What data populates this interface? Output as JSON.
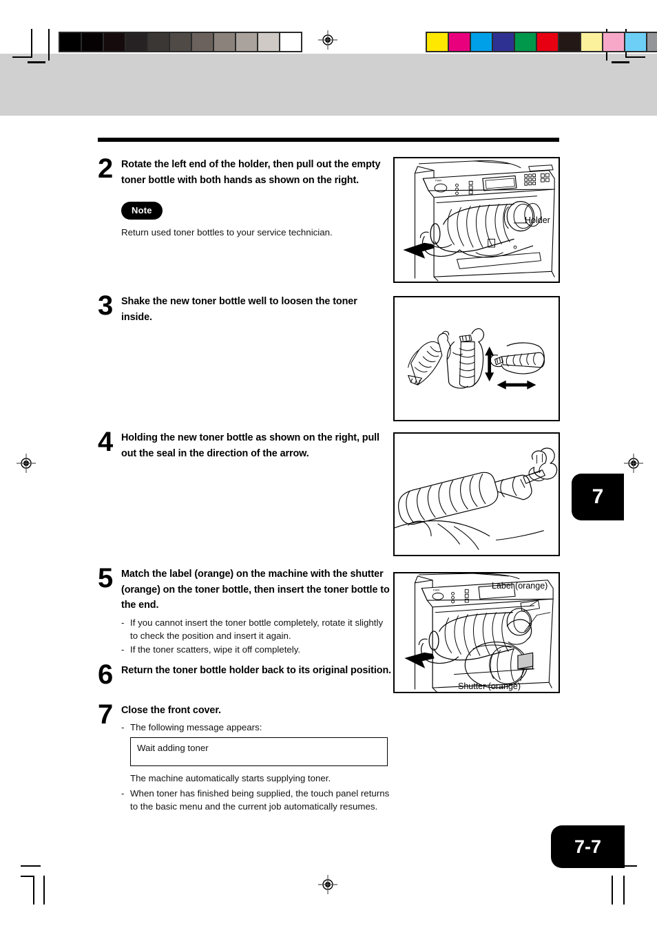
{
  "document": {
    "page_number": "7-7",
    "chapter_tab": "7"
  },
  "prepress": {
    "gray_wedge": [
      "#000000",
      "#060204",
      "#150a0c",
      "#262223",
      "#3b3735",
      "#4f4a46",
      "#6b625d",
      "#8b827c",
      "#aaa29c",
      "#cfcac5",
      "#ffffff"
    ],
    "color_bar": [
      "#ffe800",
      "#e8007d",
      "#00a0e9",
      "#2e3192",
      "#00984a",
      "#e60012",
      "#231815",
      "#fbf09c",
      "#f7a8c8",
      "#6dcff6",
      "#939598"
    ],
    "registration_icon": "registration-target-icon"
  },
  "steps": [
    {
      "number": "2",
      "title": "Rotate the left end of the holder, then pull out the empty toner bottle with both hands as shown on the right.",
      "note_badge": "Note",
      "note_text": "Return used toner bottles to your service technician."
    },
    {
      "number": "3",
      "title": "Shake the new toner bottle well to loosen the toner inside."
    },
    {
      "number": "4",
      "title": "Holding the new toner bottle as shown on the right, pull out the seal in the direction of the arrow."
    },
    {
      "number": "5",
      "title": "Match the label (orange) on the machine with the shutter (orange) on the toner bottle, then insert the toner bottle to the end.",
      "substeps": [
        "If you cannot insert the toner bottle completely, rotate it slightly to check the position and insert it again.",
        "If the toner scatters, wipe it off completely."
      ]
    },
    {
      "number": "6",
      "title": "Return the toner bottle holder back to its original position."
    },
    {
      "number": "7",
      "title": "Close the front cover.",
      "substep_intro": "The following message appears:",
      "message_box": "Wait adding toner",
      "after_message": "The machine automatically starts supplying toner.",
      "substep_last": "When toner has finished being supplied, the touch panel returns to the basic menu and the current job automatically resumes."
    }
  ],
  "figures": {
    "fig2": {
      "name": "copier-toner-removal-illustration",
      "callouts": [
        {
          "text": "Holder"
        }
      ]
    },
    "fig3": {
      "name": "shake-toner-bottle-illustration",
      "callouts": []
    },
    "fig4": {
      "name": "pull-seal-illustration",
      "callouts": []
    },
    "fig5": {
      "name": "insert-toner-bottle-illustration",
      "callouts": [
        {
          "text": "Label (orange)"
        },
        {
          "text": "Shutter (orange)"
        }
      ]
    }
  },
  "dash": "-"
}
